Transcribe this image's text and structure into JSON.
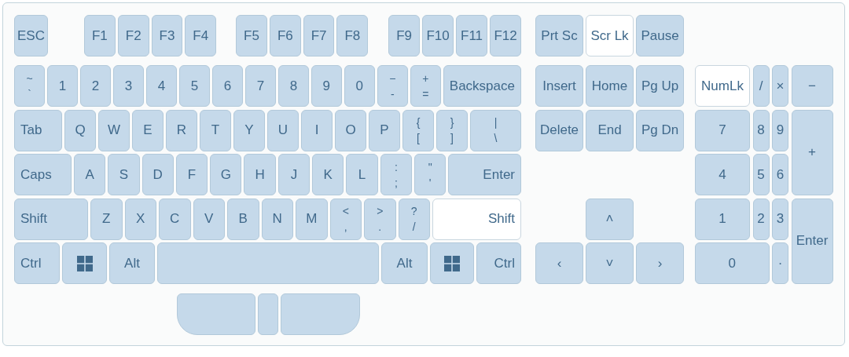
{
  "keyboard": {
    "main_rows": [
      [
        {
          "kind": "text",
          "label": "ESC",
          "on": false
        },
        {
          "kind": "text",
          "label": "F1",
          "on": false
        },
        {
          "kind": "text",
          "label": "F2",
          "on": false
        },
        {
          "kind": "text",
          "label": "F3",
          "on": false
        },
        {
          "kind": "text",
          "label": "F4",
          "on": false
        },
        {
          "kind": "text",
          "label": "F5",
          "on": false
        },
        {
          "kind": "text",
          "label": "F6",
          "on": false
        },
        {
          "kind": "text",
          "label": "F7",
          "on": false
        },
        {
          "kind": "text",
          "label": "F8",
          "on": false
        },
        {
          "kind": "text",
          "label": "F9",
          "on": false
        },
        {
          "kind": "text",
          "label": "F10",
          "on": false
        },
        {
          "kind": "text",
          "label": "F11",
          "on": false
        },
        {
          "kind": "text",
          "label": "F12",
          "on": false
        }
      ],
      [
        {
          "kind": "dual",
          "upper": "~",
          "lower": "`",
          "on": false
        },
        {
          "kind": "text",
          "label": "1",
          "on": false
        },
        {
          "kind": "text",
          "label": "2",
          "on": false
        },
        {
          "kind": "text",
          "label": "3",
          "on": false
        },
        {
          "kind": "text",
          "label": "4",
          "on": false
        },
        {
          "kind": "text",
          "label": "5",
          "on": false
        },
        {
          "kind": "text",
          "label": "6",
          "on": false
        },
        {
          "kind": "text",
          "label": "7",
          "on": false
        },
        {
          "kind": "text",
          "label": "8",
          "on": false
        },
        {
          "kind": "text",
          "label": "9",
          "on": false
        },
        {
          "kind": "text",
          "label": "0",
          "on": false
        },
        {
          "kind": "dual",
          "upper": "−",
          "lower": "-",
          "on": false
        },
        {
          "kind": "dual",
          "upper": "+",
          "lower": "=",
          "on": false
        },
        {
          "kind": "text",
          "label": "Backspace",
          "on": false
        }
      ],
      [
        {
          "kind": "text",
          "label": "Tab",
          "on": false
        },
        {
          "kind": "text",
          "label": "Q",
          "on": false
        },
        {
          "kind": "text",
          "label": "W",
          "on": false
        },
        {
          "kind": "text",
          "label": "E",
          "on": false
        },
        {
          "kind": "text",
          "label": "R",
          "on": false
        },
        {
          "kind": "text",
          "label": "T",
          "on": false
        },
        {
          "kind": "text",
          "label": "Y",
          "on": false
        },
        {
          "kind": "text",
          "label": "U",
          "on": false
        },
        {
          "kind": "text",
          "label": "I",
          "on": false
        },
        {
          "kind": "text",
          "label": "O",
          "on": false
        },
        {
          "kind": "text",
          "label": "P",
          "on": false
        },
        {
          "kind": "dual",
          "upper": "{",
          "lower": "[",
          "on": false
        },
        {
          "kind": "dual",
          "upper": "}",
          "lower": "]",
          "on": false
        },
        {
          "kind": "dual",
          "upper": "|",
          "lower": "\\",
          "on": false
        }
      ],
      [
        {
          "kind": "text",
          "label": "Caps",
          "on": false
        },
        {
          "kind": "text",
          "label": "A",
          "on": false
        },
        {
          "kind": "text",
          "label": "S",
          "on": false
        },
        {
          "kind": "text",
          "label": "D",
          "on": false
        },
        {
          "kind": "text",
          "label": "F",
          "on": false
        },
        {
          "kind": "text",
          "label": "G",
          "on": false
        },
        {
          "kind": "text",
          "label": "H",
          "on": false
        },
        {
          "kind": "text",
          "label": "J",
          "on": false
        },
        {
          "kind": "text",
          "label": "K",
          "on": false
        },
        {
          "kind": "text",
          "label": "L",
          "on": false
        },
        {
          "kind": "dual",
          "upper": ":",
          "lower": ";",
          "on": false
        },
        {
          "kind": "dual",
          "upper": "\"",
          "lower": "'",
          "on": false
        },
        {
          "kind": "text",
          "label": "Enter",
          "on": false
        }
      ],
      [
        {
          "kind": "text",
          "label": "Shift",
          "on": false
        },
        {
          "kind": "text",
          "label": "Z",
          "on": false
        },
        {
          "kind": "text",
          "label": "X",
          "on": false
        },
        {
          "kind": "text",
          "label": "C",
          "on": false
        },
        {
          "kind": "text",
          "label": "V",
          "on": false
        },
        {
          "kind": "text",
          "label": "B",
          "on": false
        },
        {
          "kind": "text",
          "label": "N",
          "on": false
        },
        {
          "kind": "text",
          "label": "M",
          "on": false
        },
        {
          "kind": "dual",
          "upper": "<",
          "lower": ",",
          "on": false
        },
        {
          "kind": "dual",
          "upper": ">",
          "lower": ".",
          "on": false
        },
        {
          "kind": "dual",
          "upper": "?",
          "lower": "/",
          "on": false
        },
        {
          "kind": "text",
          "label": "Shift",
          "on": true
        }
      ],
      [
        {
          "kind": "text",
          "label": "Ctrl",
          "on": false
        },
        {
          "kind": "windows",
          "on": false
        },
        {
          "kind": "text",
          "label": "Alt",
          "on": false
        },
        {
          "kind": "space",
          "on": false
        },
        {
          "kind": "text",
          "label": "Alt",
          "on": false
        },
        {
          "kind": "windows",
          "on": false
        },
        {
          "kind": "text",
          "label": "Ctrl",
          "on": false
        }
      ]
    ],
    "touchpad_buttons": [
      {
        "on": false
      },
      {
        "on": false
      },
      {
        "on": false
      }
    ],
    "navigation_rows": [
      [
        {
          "kind": "text",
          "label": "Prt Sc",
          "on": false
        },
        {
          "kind": "text",
          "label": "Scr Lk",
          "on": true
        },
        {
          "kind": "text",
          "label": "Pause",
          "on": false
        }
      ],
      [
        {
          "kind": "text",
          "label": "Insert",
          "on": false
        },
        {
          "kind": "text",
          "label": "Home",
          "on": false
        },
        {
          "kind": "text",
          "label": "Pg Up",
          "on": false
        }
      ],
      [
        {
          "kind": "text",
          "label": "Delete",
          "on": false
        },
        {
          "kind": "text",
          "label": "End",
          "on": false
        },
        {
          "kind": "text",
          "label": "Pg Dn",
          "on": false
        }
      ],
      [
        {
          "kind": "text",
          "label": "˄",
          "on": false
        }
      ],
      [
        {
          "kind": "text",
          "label": "‹",
          "on": false
        },
        {
          "kind": "text",
          "label": "˅",
          "on": false
        },
        {
          "kind": "text",
          "label": "›",
          "on": false
        }
      ]
    ],
    "numpad": [
      {
        "kind": "text",
        "label": "NumLk",
        "on": true
      },
      {
        "kind": "text",
        "label": "/",
        "on": false
      },
      {
        "kind": "text",
        "label": "×",
        "on": false
      },
      {
        "kind": "text",
        "label": "−",
        "on": false
      },
      {
        "kind": "text",
        "label": "7",
        "on": false
      },
      {
        "kind": "text",
        "label": "8",
        "on": false
      },
      {
        "kind": "text",
        "label": "9",
        "on": false
      },
      {
        "kind": "text",
        "label": "+",
        "on": false
      },
      {
        "kind": "text",
        "label": "4",
        "on": false
      },
      {
        "kind": "text",
        "label": "5",
        "on": false
      },
      {
        "kind": "text",
        "label": "6",
        "on": false
      },
      {
        "kind": "text",
        "label": "1",
        "on": false
      },
      {
        "kind": "text",
        "label": "2",
        "on": false
      },
      {
        "kind": "text",
        "label": "3",
        "on": false
      },
      {
        "kind": "text",
        "label": "Enter",
        "on": false
      },
      {
        "kind": "text",
        "label": "0",
        "on": false
      },
      {
        "kind": "text",
        "label": "·",
        "on": false
      }
    ]
  }
}
